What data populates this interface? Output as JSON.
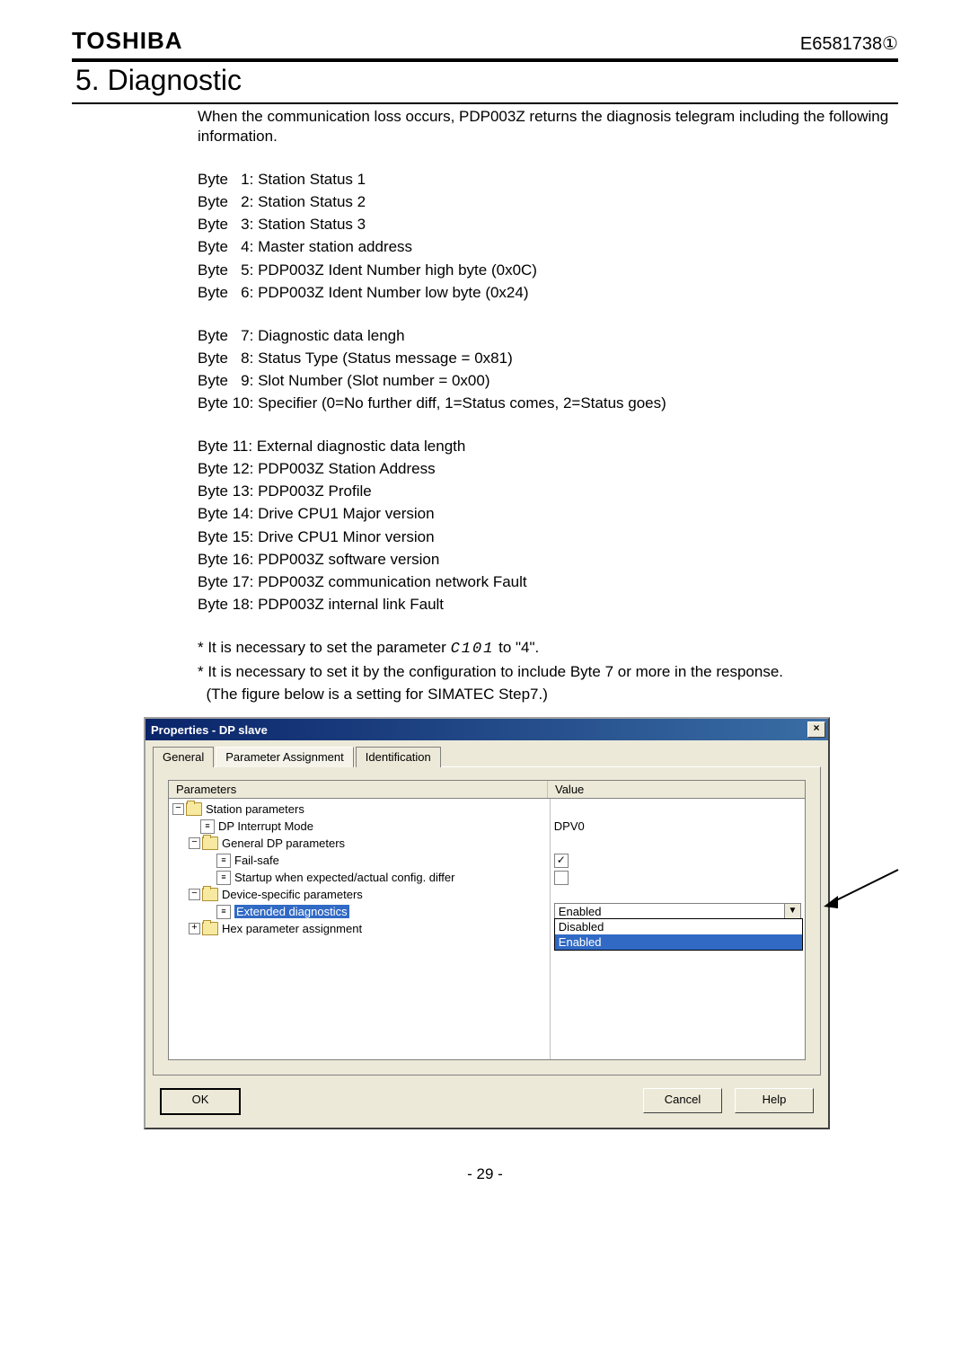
{
  "header": {
    "brand": "TOSHIBA",
    "doc_code": "E6581738①"
  },
  "section": {
    "title": "5.  Diagnostic"
  },
  "intro": "When the communication loss occurs, PDP003Z returns the diagnosis telegram including the following information.",
  "bytes_a": [
    "Byte   1: Station Status 1",
    "Byte   2: Station Status 2",
    "Byte   3: Station Status 3",
    "Byte   4: Master station address",
    "Byte   5: PDP003Z Ident Number high byte (0x0C)",
    "Byte   6: PDP003Z Ident Number low byte (0x24)"
  ],
  "bytes_b": [
    "Byte   7: Diagnostic data lengh",
    "Byte   8: Status Type (Status message = 0x81)",
    "Byte   9: Slot Number (Slot number = 0x00)",
    "Byte 10: Specifier (0=No further diff, 1=Status comes, 2=Status goes)"
  ],
  "bytes_c": [
    "Byte 11: External diagnostic data length",
    "Byte 12: PDP003Z Station Address",
    "Byte 13: PDP003Z Profile",
    "Byte 14: Drive CPU1 Major version",
    "Byte 15: Drive CPU1 Minor version",
    "Byte 16: PDP003Z software version",
    "Byte 17: PDP003Z communication network Fault",
    "Byte 18: PDP003Z internal link Fault"
  ],
  "notes": {
    "n1_a": "* It is necessary to set the parameter ",
    "n1_param": "C101",
    "n1_b": " to \"4\".",
    "n2": "* It is necessary to set it by the configuration to include Byte 7 or more in the response.",
    "n3": "  (The figure below is a setting for SIMATEC Step7.)"
  },
  "dialog": {
    "title": "Properties - DP slave",
    "close_glyph": "×",
    "tabs": {
      "t1": "General",
      "t2": "Parameter Assignment",
      "t3": "Identification"
    },
    "grid": {
      "h_param": "Parameters",
      "h_val": "Value"
    },
    "tree": {
      "r0": "Station parameters",
      "r1": "DP Interrupt Mode",
      "r2": "General DP parameters",
      "r3": "Fail-safe",
      "r4": "Startup when expected/actual config. differ",
      "r5": "Device-specific parameters",
      "r6": "Extended diagnostics",
      "r7": "Hex parameter assignment",
      "exp_minus": "−",
      "exp_plus": "+",
      "leaf_glyph": "≡"
    },
    "values": {
      "v1": "DPV0",
      "v3_checked": "✓",
      "v4_checked": "",
      "v6": "Enabled"
    },
    "dropdown": {
      "opt1": "Disabled",
      "opt2": "Enabled",
      "arrow": "▼"
    },
    "buttons": {
      "ok": "OK",
      "cancel": "Cancel",
      "help": "Help"
    }
  },
  "page_number": "- 29 -"
}
